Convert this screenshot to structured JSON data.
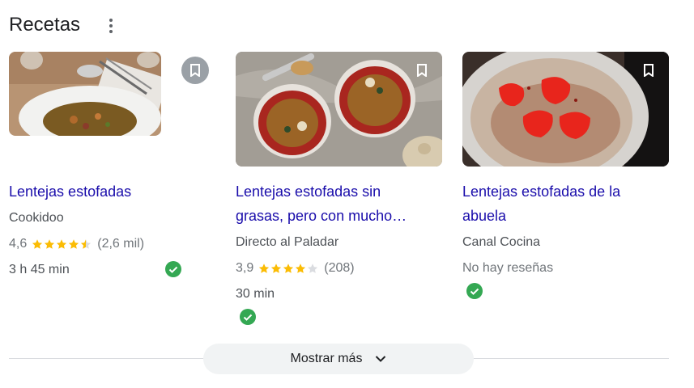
{
  "section": {
    "title": "Recetas"
  },
  "cards": [
    {
      "title_lines": [
        "Lentejas estofadas"
      ],
      "source": "Cookidoo",
      "rating": {
        "value": "4,6",
        "stars": 4.5,
        "count": "(2,6 mil)"
      },
      "time": "3 h 45 min",
      "no_reviews": ""
    },
    {
      "title_lines": [
        "Lentejas estofadas sin",
        "grasas, pero con mucho…"
      ],
      "source": "Directo al Paladar",
      "rating": {
        "value": "3,9",
        "stars": 4,
        "count": "(208)"
      },
      "time": "30 min",
      "no_reviews": ""
    },
    {
      "title_lines": [
        "Lentejas estofadas de la",
        "abuela"
      ],
      "source": "Canal Cocina",
      "rating": null,
      "time": "",
      "no_reviews": "No hay reseñas"
    }
  ],
  "show_more": {
    "label": "Mostrar más"
  },
  "colors": {
    "link": "#1a0dab",
    "star": "#fbbc04",
    "check": "#34a853",
    "star_empty": "#dadce0"
  }
}
